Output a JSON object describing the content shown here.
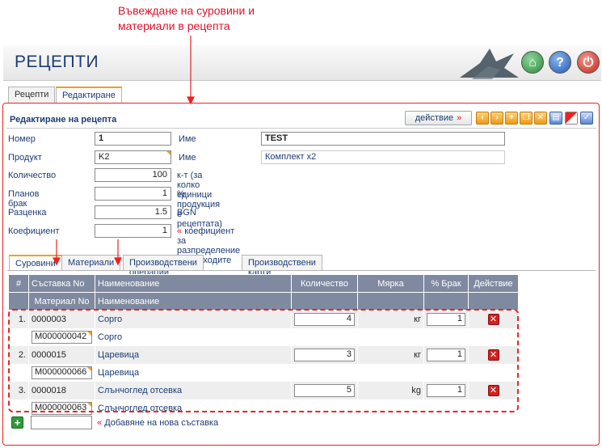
{
  "annotation": {
    "line1": "Въвеждане на суровини и",
    "line2": "материали в рецепта"
  },
  "header": {
    "title": "РЕЦЕПТИ",
    "home_icon": "home-icon",
    "help_icon": "help-icon",
    "power_icon": "power-icon"
  },
  "top_tabs": [
    {
      "label": "Рецепти"
    },
    {
      "label": "Редактиране"
    }
  ],
  "panel": {
    "title": "Редактиране на рецепта",
    "action_label": "действие",
    "action_arrow": "»",
    "toolbar_icons": [
      "prev-icon",
      "next-icon",
      "add-icon",
      "copy-icon",
      "delete-icon",
      "print-icon",
      "flag-icon",
      "confirm-icon"
    ]
  },
  "form": {
    "number": {
      "label": "Номер",
      "value": "1"
    },
    "name": {
      "label": "Име",
      "value": "TEST"
    },
    "product": {
      "label": "Продукт",
      "value": "K2"
    },
    "product_name": {
      "label": "Име",
      "value": "Комплект x2"
    },
    "quantity": {
      "label": "Количество",
      "value": "100",
      "unit": "к-т",
      "note": "(за колко единици продукция е рецептата)"
    },
    "waste": {
      "label": "Планов брак",
      "value": "1",
      "unit": "%"
    },
    "cost": {
      "label": "Разценка",
      "value": "1.5",
      "unit": "BGN"
    },
    "coefficient": {
      "label": "Коефициент",
      "value": "1",
      "marker": "«",
      "note": "коефициент за разпределение на разходите"
    }
  },
  "sub_tabs": [
    {
      "label": "Суровини"
    },
    {
      "label": "Материали"
    },
    {
      "label": "Производствени операции"
    },
    {
      "label": "Производствени карти"
    }
  ],
  "grid": {
    "headers": {
      "num": "#",
      "component": "Съставка No",
      "name": "Наименование",
      "quantity": "Количество",
      "unit": "Мярка",
      "waste": "% Брак",
      "action": "Действие"
    },
    "subheaders": {
      "material": "Материал No",
      "name": "Наименование"
    },
    "rows": [
      {
        "idx": "1.",
        "component": "0000003",
        "name": "Сорго",
        "quantity": "4",
        "unit": "кг",
        "waste": "1",
        "material": "M000000042",
        "material_name": "Сорго"
      },
      {
        "idx": "2.",
        "component": "0000015",
        "name": "Царевица",
        "quantity": "3",
        "unit": "кг",
        "waste": "1",
        "material": "M000000066",
        "material_name": "Царевица"
      },
      {
        "idx": "3.",
        "component": "0000018",
        "name": "Слънчоглед отсевка",
        "quantity": "5",
        "unit": "kg",
        "waste": "1",
        "material": "M000000063",
        "material_name": "Слънчоглед отсевка"
      }
    ],
    "add": {
      "marker": "«",
      "label": "Добавяне на нова съставка",
      "value": ""
    }
  },
  "colors": {
    "accent_red": "#e0102a",
    "header_grey": "#7f8aa0",
    "tab_orange": "#f0a020"
  }
}
